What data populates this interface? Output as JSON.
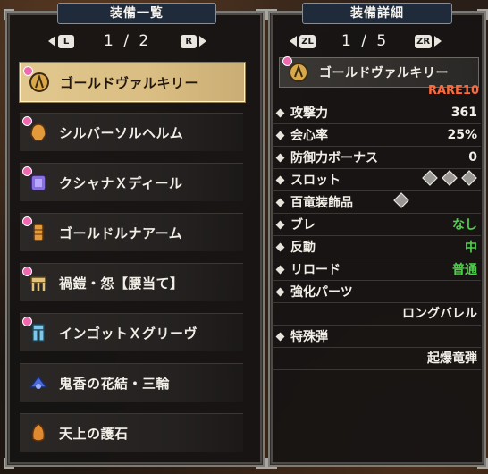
{
  "left": {
    "title": "装備一覧",
    "pager": {
      "left_key": "L",
      "right_key": "R",
      "page": "1 / 2"
    },
    "items": [
      {
        "label": "ゴールドヴァルキリー",
        "icon": "gunlance-icon",
        "selected": true
      },
      {
        "label": "シルバーソルヘルム",
        "icon": "helm-icon",
        "selected": false
      },
      {
        "label": "クシャナＸディール",
        "icon": "chest-armor-icon",
        "selected": false
      },
      {
        "label": "ゴールドルナアーム",
        "icon": "arm-armor-icon",
        "selected": false
      },
      {
        "label": "禍鎧・怨【腰当て】",
        "icon": "waist-armor-icon",
        "selected": false
      },
      {
        "label": "インゴットＸグリーヴ",
        "icon": "leg-armor-icon",
        "selected": false
      },
      {
        "label": "鬼香の花結・三輪",
        "icon": "hairpiece-icon",
        "selected": false
      },
      {
        "label": "天上の護石",
        "icon": "talisman-icon",
        "selected": false
      }
    ]
  },
  "right": {
    "title": "装備詳細",
    "pager": {
      "left_key": "ZL",
      "right_key": "ZR",
      "page": "1 / 5"
    },
    "weapon_name": "ゴールドヴァルキリー",
    "rarity": "RARE10",
    "stats": [
      {
        "label": "攻撃力",
        "value": "361"
      },
      {
        "label": "会心率",
        "value": "25%"
      },
      {
        "label": "防御力ボーナス",
        "value": "0"
      },
      {
        "label": "スロット",
        "value": ""
      },
      {
        "label": "百竜装飾品",
        "value": ""
      },
      {
        "label": "ブレ",
        "value": "なし",
        "color": "#4ed14a"
      },
      {
        "label": "反動",
        "value": "中",
        "color": "#4ed14a"
      },
      {
        "label": "リロード",
        "value": "普通",
        "color": "#4ed14a"
      },
      {
        "label": "強化パーツ",
        "value": ""
      }
    ],
    "mod_value": "ロングバレル",
    "special_ammo_label": "特殊弾",
    "special_ammo_value": "起爆竜弾"
  },
  "colors": {
    "accent_gold": "#e2c88f",
    "rare_orange": "#ff6a3d",
    "good_green": "#4ed14a",
    "badge_pink": "#f069b0"
  }
}
